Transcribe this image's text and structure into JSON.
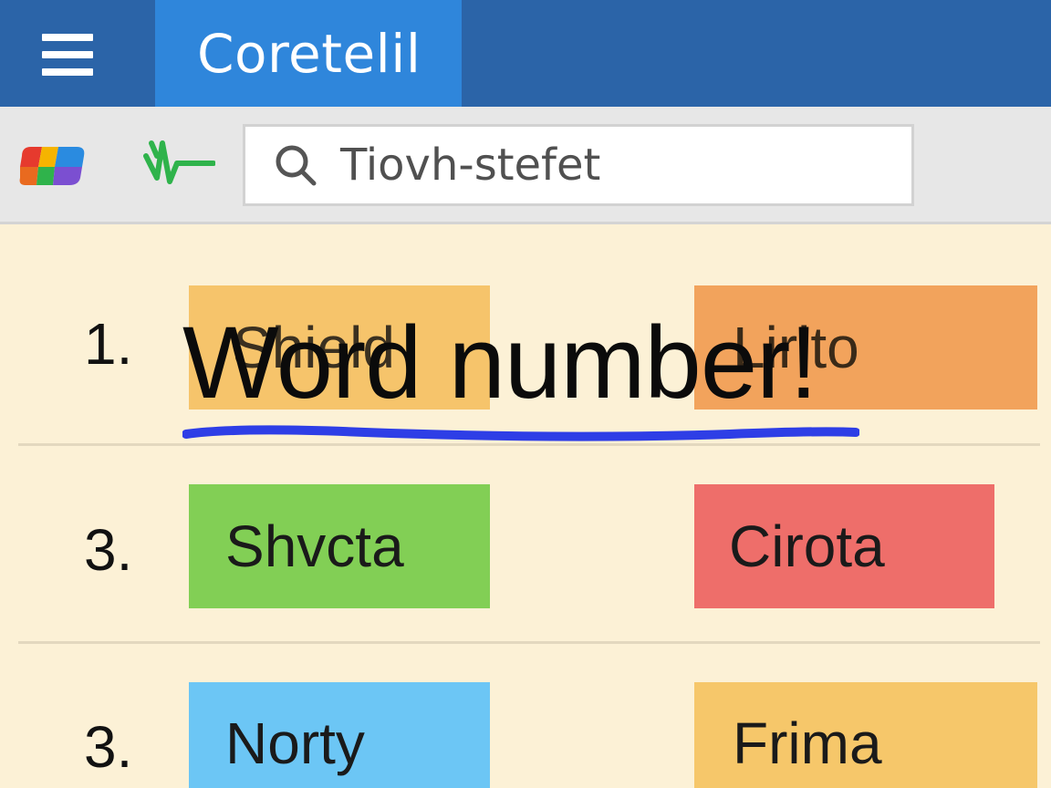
{
  "titlebar": {
    "app_title": "Coretelil",
    "menu_icon": "hamburger-menu-icon"
  },
  "toolbar": {
    "logo_icon": "colorful-logo-icon",
    "signal_icon": "green-waveform-icon",
    "search": {
      "icon": "search-icon",
      "value": "Tiovh-stefet"
    }
  },
  "list": {
    "rows": [
      {
        "number": "1.",
        "left": "Shield",
        "right": "Lirito"
      },
      {
        "number": "3.",
        "left": "Shvcta",
        "right": "Cirota"
      },
      {
        "number": "3.",
        "left": "Norty",
        "right": "Frima"
      }
    ]
  },
  "overlay": {
    "text": "Word number!",
    "underline_color": "#2e3ee6"
  },
  "colors": {
    "titlebar": "#2b64a8",
    "app_tab": "#2f86db",
    "toolbar": "#e7e7e7",
    "content_bg": "#fcf1d6",
    "tag_orange_light": "#f6c46b",
    "tag_orange": "#f2a35c",
    "tag_green": "#82cf55",
    "tag_red": "#ee6e6a",
    "tag_blue": "#6cc6f5",
    "tag_yellow": "#f6c76a"
  }
}
